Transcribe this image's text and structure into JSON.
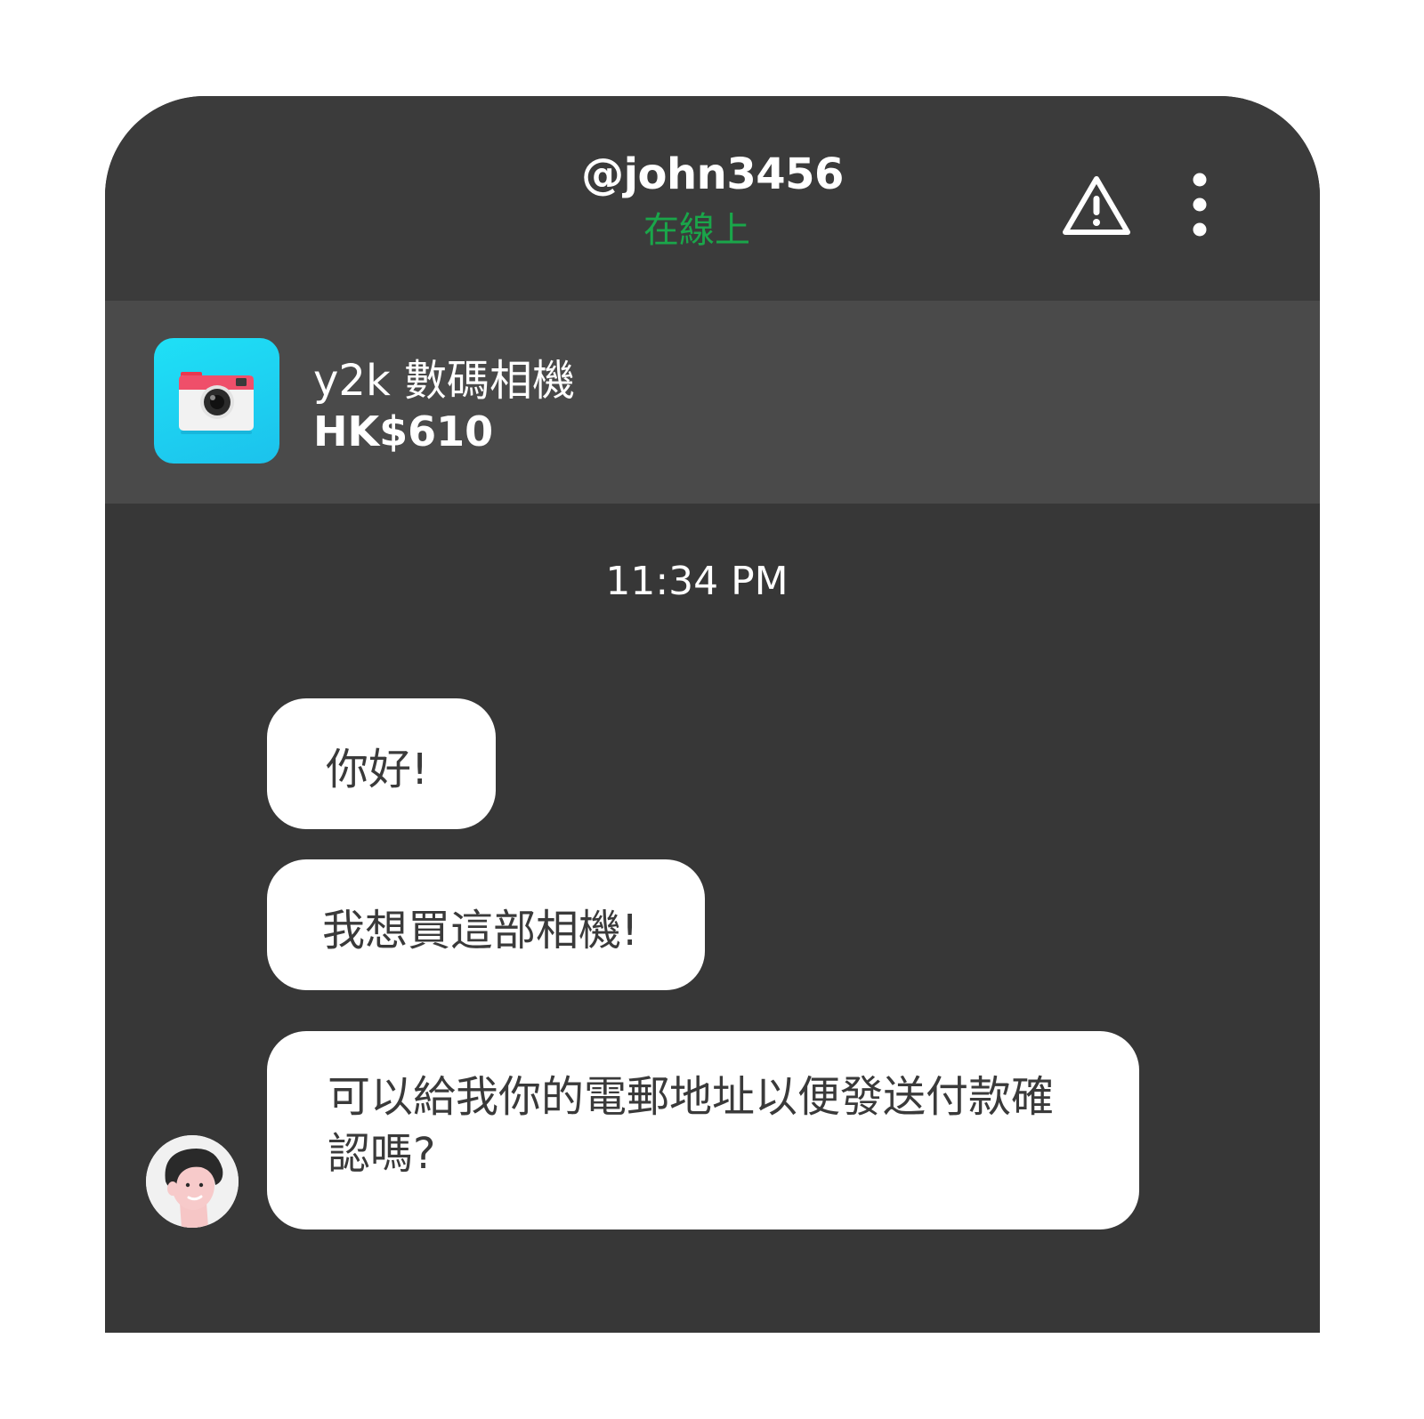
{
  "header": {
    "username": "@john3456",
    "status": "在線上",
    "status_color": "#1aa64a",
    "report_icon": "warning-triangle-icon",
    "more_icon": "more-vertical-icon"
  },
  "product": {
    "title": "y2k 數碼相機",
    "price": "HK$610",
    "thumbnail_icon": "camera-icon",
    "thumbnail_color": "#1fd6f2"
  },
  "chat": {
    "timestamp": "11:34 PM",
    "messages": [
      {
        "text": "你好!"
      },
      {
        "text": "我想買這部相機!"
      },
      {
        "text": "可以給我你的電郵地址以便發送付款確認嗎?"
      }
    ]
  }
}
